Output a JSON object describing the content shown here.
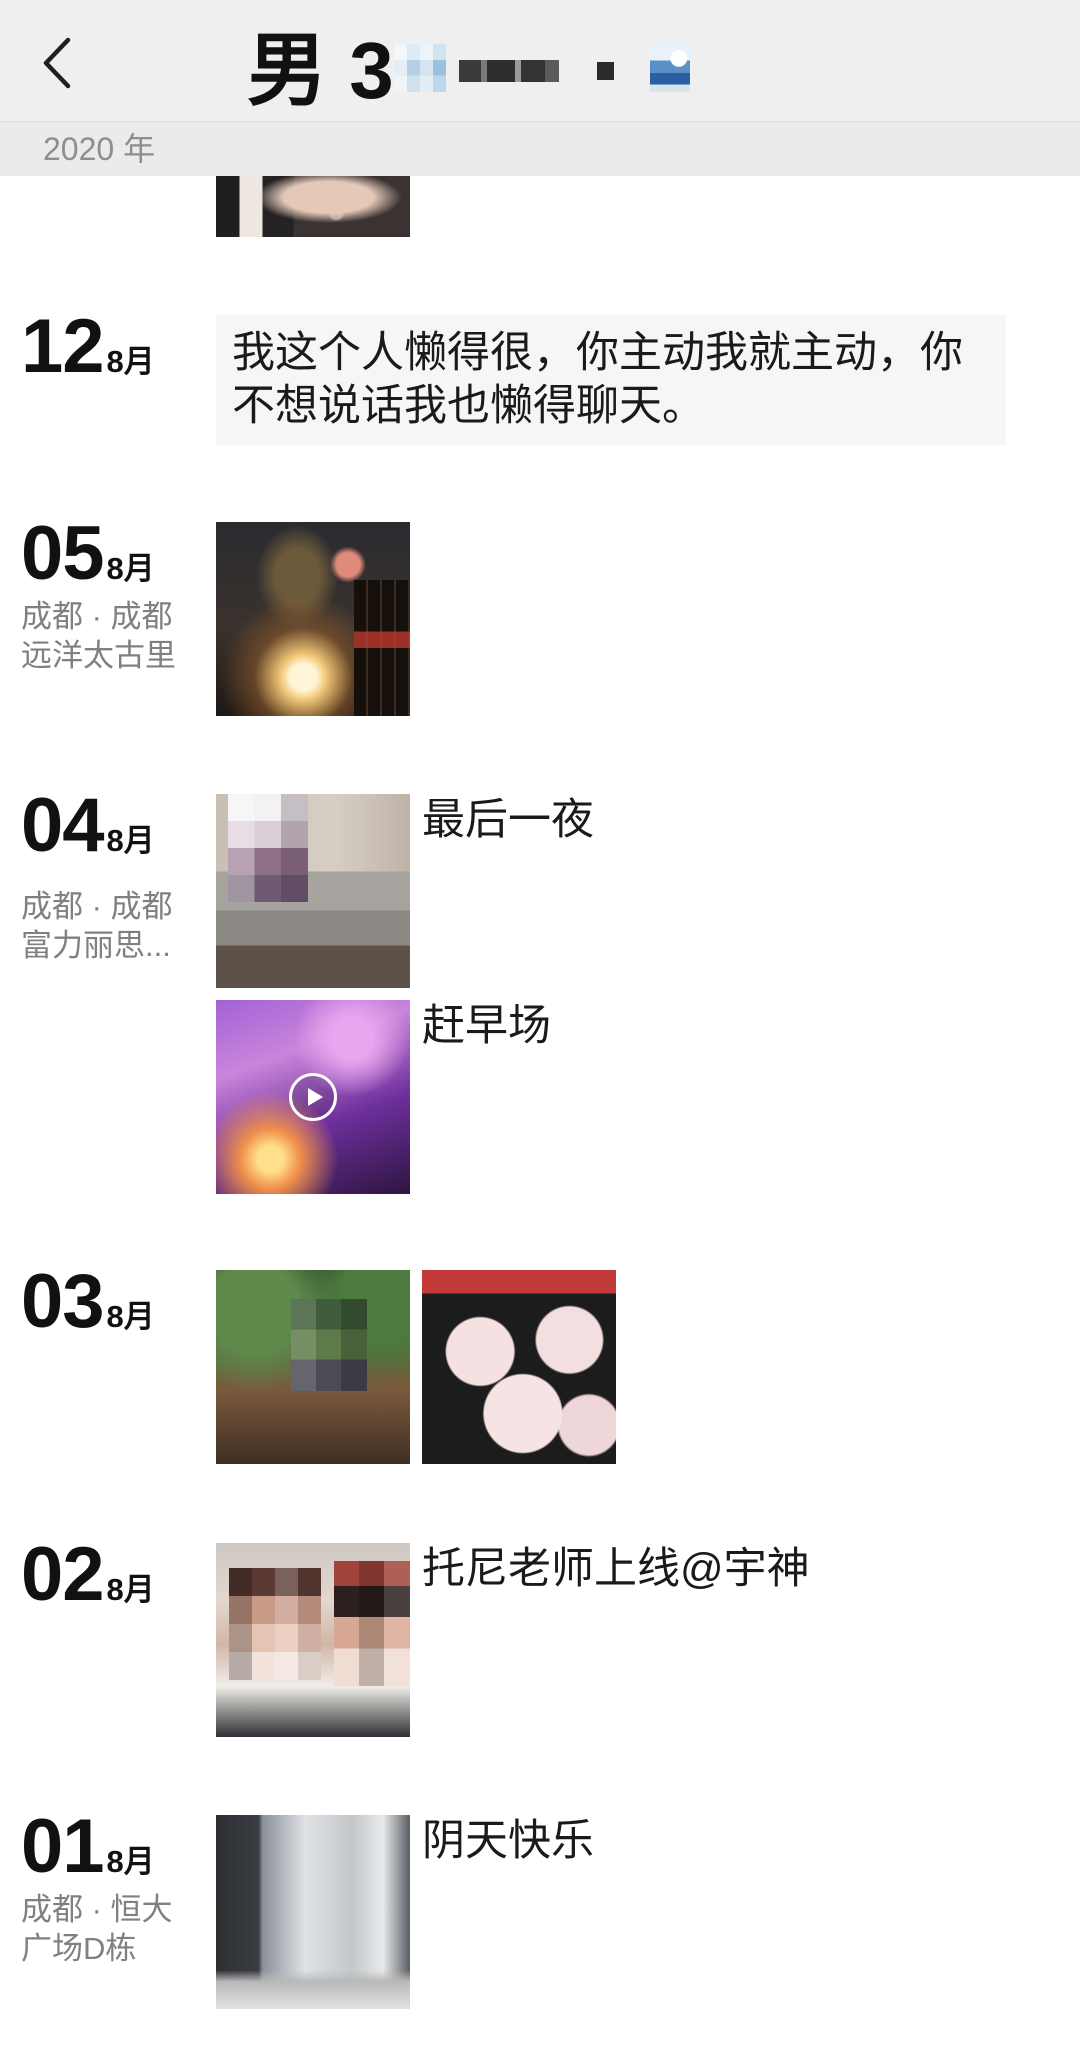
{
  "header": {
    "title": "男 3",
    "back_icon": "chevron-left-icon"
  },
  "year_label": "2020 年",
  "colors": {
    "header-bg": "#efefef",
    "year-bg": "#ebebeb",
    "text": "#1a1a1a",
    "muted": "#808080",
    "box-bg": "#f6f6f6"
  },
  "scrolled_post": {
    "photos": 1
  },
  "entries": [
    {
      "day": "12",
      "month": "8月",
      "posts": [
        {
          "text": "我这个人懒得很，你主动我就主动，你不想说话我也懒得聊天。"
        }
      ]
    },
    {
      "day": "05",
      "month": "8月",
      "location": [
        "成都 · 成都",
        "远洋太古里"
      ],
      "posts": [
        {
          "photos": 1
        }
      ]
    },
    {
      "day": "04",
      "month": "8月",
      "location": [
        "成都 · 成都",
        "富力丽思..."
      ],
      "posts": [
        {
          "photos": 1,
          "caption": "最后一夜"
        },
        {
          "photos": 1,
          "video": true,
          "play_icon": "play-icon",
          "caption": "赶早场"
        }
      ]
    },
    {
      "day": "03",
      "month": "8月",
      "posts": [
        {
          "photos": 2
        }
      ]
    },
    {
      "day": "02",
      "month": "8月",
      "posts": [
        {
          "photos": 1,
          "caption": "托尼老师上线@宇神"
        }
      ]
    },
    {
      "day": "01",
      "month": "8月",
      "location": [
        "成都 · 恒大",
        "广场D栋"
      ],
      "posts": [
        {
          "photos": 1,
          "caption": "阴天快乐"
        }
      ]
    }
  ]
}
